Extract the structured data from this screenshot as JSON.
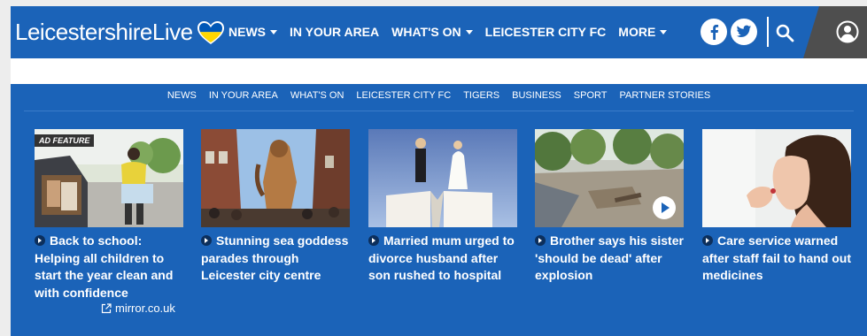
{
  "brand": {
    "name": "LeicestershireLive",
    "heart_colors": [
      "#0057b7",
      "#ffd700"
    ]
  },
  "main_nav": [
    {
      "label": "NEWS",
      "dropdown": true
    },
    {
      "label": "IN YOUR AREA",
      "dropdown": false
    },
    {
      "label": "WHAT'S ON",
      "dropdown": true
    },
    {
      "label": "LEICESTER CITY FC",
      "dropdown": false
    },
    {
      "label": "MORE",
      "dropdown": true
    }
  ],
  "header_icons": [
    "facebook-icon",
    "twitter-icon",
    "search-icon",
    "account-icon"
  ],
  "sub_nav": [
    "NEWS",
    "IN YOUR AREA",
    "WHAT'S ON",
    "LEICESTER CITY FC",
    "TIGERS",
    "BUSINESS",
    "SPORT",
    "PARTNER STORIES"
  ],
  "cards": [
    {
      "title": "Back to school: Helping all children to start the year clean and with confidence",
      "tag": "AD FEATURE",
      "source": "mirror.co.uk"
    },
    {
      "title": "Stunning sea goddess parades through Leicester city centre"
    },
    {
      "title": "Married mum urged to divorce husband after son rushed to hospital"
    },
    {
      "title": "Brother says his sister 'should be dead' after explosion",
      "has_video": true
    },
    {
      "title": "Care service warned after staff fail to hand out medicines"
    }
  ],
  "colors": {
    "brand_blue": "#1b63b8",
    "account_bg": "#4e4e4e",
    "page_bg": "#ededed"
  }
}
